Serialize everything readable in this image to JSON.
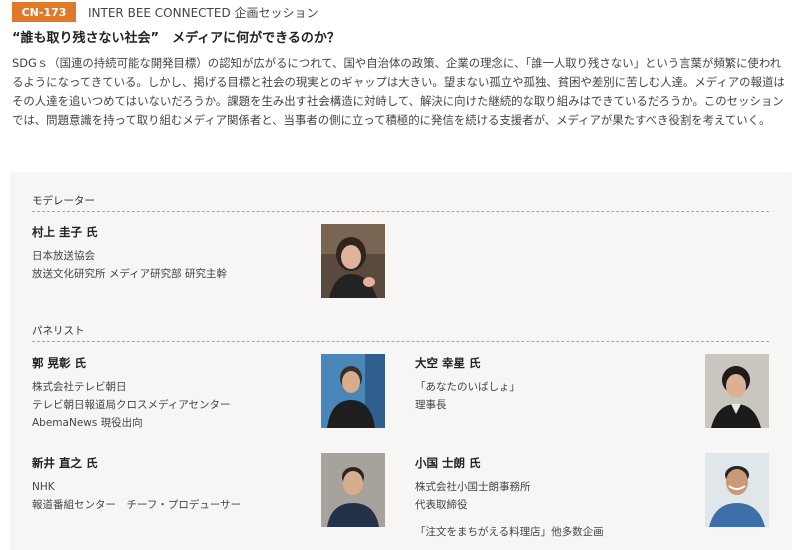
{
  "header": {
    "badge": "CN-173",
    "session_type": "INTER BEE CONNECTED 企画セッション"
  },
  "title": "“誰も取り残さない社会”　メディアに何ができるのか？",
  "description": "SDGｓ（国連の持続可能な開発目標）の認知が広がるにつれて、国や自治体の政策、企業の理念に、「誰一人取り残さない」という言葉が頻繁に使われるようになってきている。しかし、掲げる目標と社会の現実とのギャップは大きい。望まない孤立や孤独、貧困や差別に苦しむ人達。メディアの報道はその人達を追いつめてはいないだろうか。課題を生み出す社会構造に対峙して、解決に向けた継続的な取り組みはできているだろうか。このセッションでは、問題意識を持って取り組むメディア関係者と、当事者の側に立って積極的に発信を続ける支援者が、メディアが果たすべき役割を考えていく。",
  "moderator_label": "モデレーター",
  "panelist_label": "パネリスト",
  "moderator": {
    "name": "村上 圭子 氏",
    "org": "日本放送協会",
    "role": "放送文化研究所 メディア研究部 研究主幹"
  },
  "panelists": [
    {
      "name": "郭 晃彰 氏",
      "lines": [
        "株式会社テレビ朝日",
        "テレビ朝日報道局クロスメディアセンター",
        "AbemaNews 現役出向"
      ]
    },
    {
      "name": "大空 幸星 氏",
      "lines": [
        "「あなたのいばしょ」",
        "理事長"
      ]
    },
    {
      "name": "新井 直之 氏",
      "lines": [
        "NHK",
        "報道番組センター　チーフ・プロデューサー"
      ]
    },
    {
      "name": "小国 士朗 氏",
      "lines": [
        "株式会社小国士朗事務所",
        "代表取締役"
      ]
    }
  ],
  "footnote": "「注文をまちがえる料理店」他多数企画",
  "colors": {
    "accent": "#e07a2a",
    "panel_bg": "#f7f6f4",
    "rule": "#e59a4e"
  }
}
